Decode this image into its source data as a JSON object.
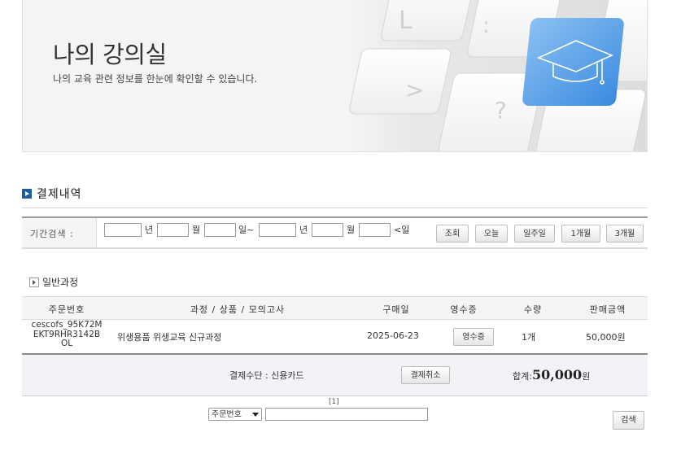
{
  "banner": {
    "title": "나의 강의실",
    "subtitle": "나의 교육 관련 정보를 한눈에 확인할 수 있습니다."
  },
  "section": {
    "title": "결제내역"
  },
  "filter": {
    "label": "기간검색 :",
    "unit_year": "년",
    "unit_month": "월",
    "unit_day_from": "일~",
    "unit_day_to": "<일",
    "buttons": [
      "조회",
      "오늘",
      "일주일",
      "1개월",
      "3개월"
    ]
  },
  "subsection": {
    "title": "일반과정"
  },
  "table": {
    "headers": [
      "주문번호",
      "과정 / 상품 / 모의고사",
      "구매일",
      "영수증",
      "수량",
      "판매금액"
    ],
    "rows": [
      {
        "order_no": "cescofs_95K72MEKT9RHR3142BOL",
        "course": "위생용품 위생교육 신규과정",
        "date": "2025-06-23",
        "receipt_label": "영수증",
        "qty": "1개",
        "price": "50,000원"
      }
    ]
  },
  "summary": {
    "payment_method": "결제수단 : 신용카드",
    "cancel_label": "결제취소",
    "total_label": "합계:",
    "total_amount": "50,000",
    "total_unit": "원"
  },
  "pager": {
    "text": "[1]"
  },
  "search": {
    "select_value": "주문번호",
    "button_label": "검색"
  }
}
